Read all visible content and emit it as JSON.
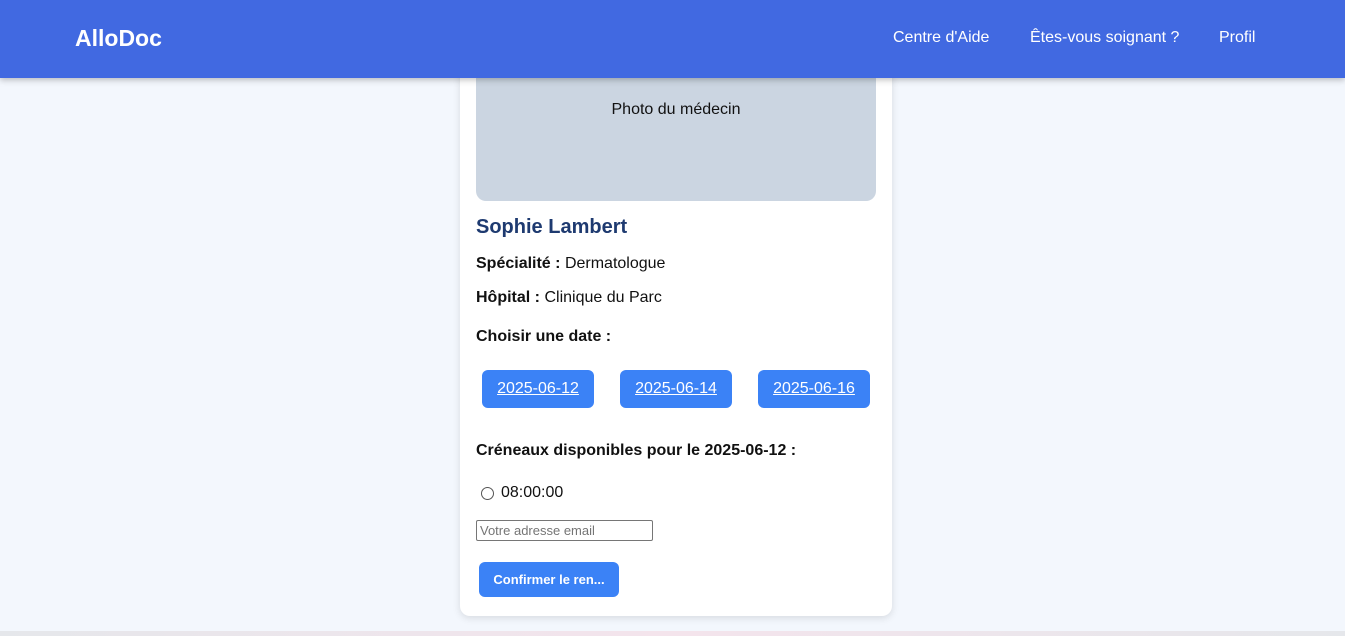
{
  "header": {
    "brand": "AlloDoc",
    "links": [
      "Centre d'Aide",
      "Êtes-vous soignant ?",
      "Profil"
    ]
  },
  "doctor": {
    "photo_placeholder": "Photo du médecin",
    "name": "Sophie Lambert",
    "specialty_label": "Spécialité :",
    "specialty": "Dermatologue",
    "hospital_label": "Hôpital :",
    "hospital": "Clinique du Parc"
  },
  "booking": {
    "choose_date_label": "Choisir une date :",
    "dates": [
      "2025-06-12",
      "2025-06-14",
      "2025-06-16"
    ],
    "slots_title": "Créneaux disponibles pour le 2025-06-12 :",
    "slots": [
      "08:00:00"
    ],
    "email_placeholder": "Votre adresse email",
    "email_value": "",
    "confirm_label": "Confirmer le ren..."
  },
  "colors": {
    "navbar": "#4169e1",
    "button": "#3b82f6",
    "name_text": "#1e3a70",
    "page_bg": "#f3f7fd",
    "photo_bg": "#cbd5e1"
  }
}
